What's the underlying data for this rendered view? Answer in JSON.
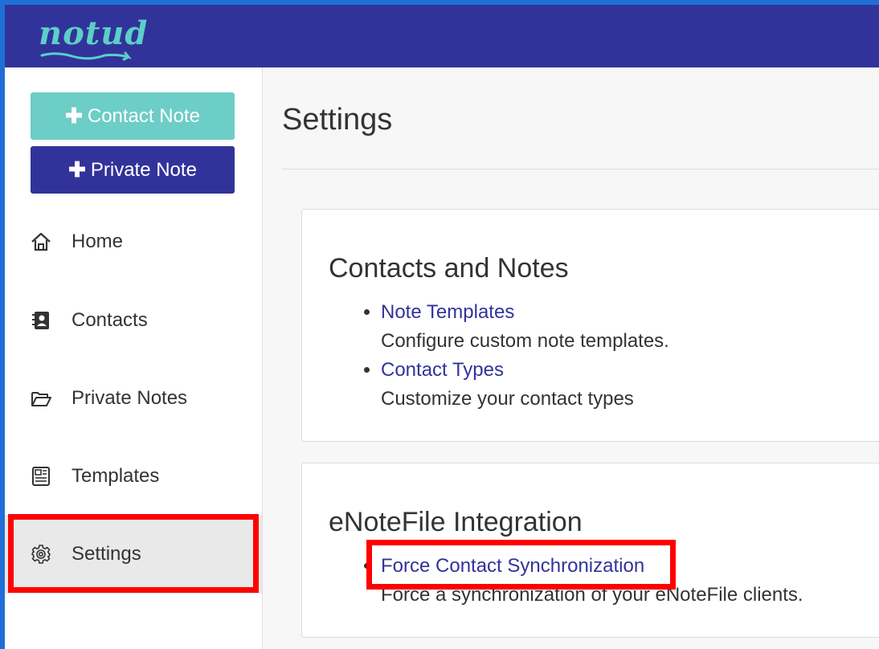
{
  "app": {
    "logo_text": "notud"
  },
  "colors": {
    "brand_dark": "#32339a",
    "brand_teal": "#6dcdc7",
    "highlight": "#ff0000"
  },
  "sidebar": {
    "buttons": [
      {
        "plus": "✚",
        "label": "Contact Note"
      },
      {
        "plus": "✚",
        "label": "Private Note"
      }
    ],
    "items": [
      {
        "label": "Home",
        "icon": "home-icon"
      },
      {
        "label": "Contacts",
        "icon": "contacts-book-icon"
      },
      {
        "label": "Private Notes",
        "icon": "folder-open-icon"
      },
      {
        "label": "Templates",
        "icon": "template-icon"
      },
      {
        "label": "Settings",
        "icon": "gear-icon",
        "active": true
      }
    ]
  },
  "main": {
    "title": "Settings",
    "sections": [
      {
        "heading": "Contacts and Notes",
        "items": [
          {
            "link": "Note Templates",
            "desc": "Configure custom note templates."
          },
          {
            "link": "Contact Types",
            "desc": "Customize your contact types"
          }
        ]
      },
      {
        "heading": "eNoteFile Integration",
        "items": [
          {
            "link": "Force Contact Synchronization",
            "desc": "Force a synchronization of your eNoteFile clients."
          }
        ]
      }
    ]
  }
}
